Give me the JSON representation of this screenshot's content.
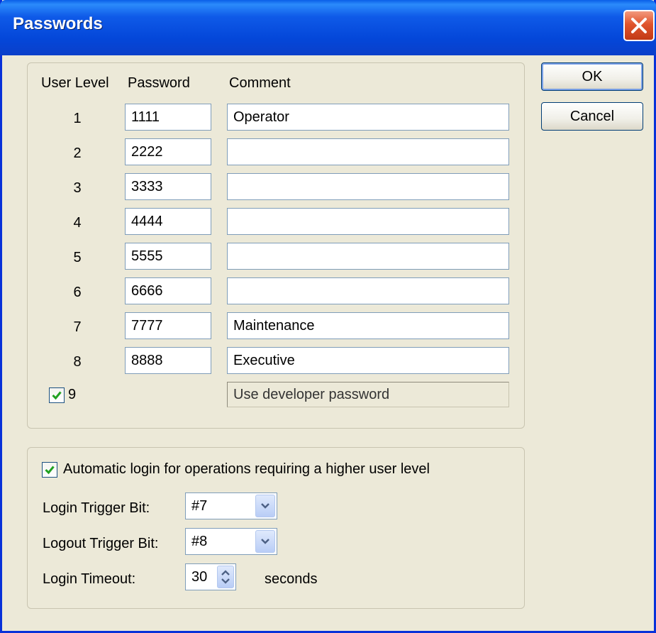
{
  "window": {
    "title": "Passwords"
  },
  "buttons": {
    "ok": "OK",
    "cancel": "Cancel"
  },
  "table": {
    "headers": {
      "user_level": "User Level",
      "password": "Password",
      "comment": "Comment"
    },
    "rows": [
      {
        "level": "1",
        "password": "1111",
        "comment": "Operator"
      },
      {
        "level": "2",
        "password": "2222",
        "comment": ""
      },
      {
        "level": "3",
        "password": "3333",
        "comment": ""
      },
      {
        "level": "4",
        "password": "4444",
        "comment": ""
      },
      {
        "level": "5",
        "password": "5555",
        "comment": ""
      },
      {
        "level": "6",
        "password": "6666",
        "comment": ""
      },
      {
        "level": "7",
        "password": "7777",
        "comment": "Maintenance"
      },
      {
        "level": "8",
        "password": "8888",
        "comment": "Executive"
      }
    ],
    "level9": {
      "label": "9",
      "checked": true,
      "comment": "Use developer password"
    }
  },
  "auto_login": {
    "checked": true,
    "label": "Automatic login for operations requiring a higher user level",
    "login_trigger": {
      "label": "Login Trigger Bit:",
      "value": "#7"
    },
    "logout_trigger": {
      "label": "Logout Trigger Bit:",
      "value": "#8"
    },
    "timeout": {
      "label": "Login Timeout:",
      "value": "30",
      "unit": "seconds"
    }
  },
  "icons": [
    "close-icon",
    "checkmark-icon",
    "chevron-down-icon",
    "spin-arrows-icon"
  ],
  "colors": {
    "titlebar": "#0A5FE8",
    "dialog_bg": "#ECE9D8",
    "close_button": "#E0542D",
    "field_border": "#7F9DB9",
    "check_green": "#21A121"
  }
}
